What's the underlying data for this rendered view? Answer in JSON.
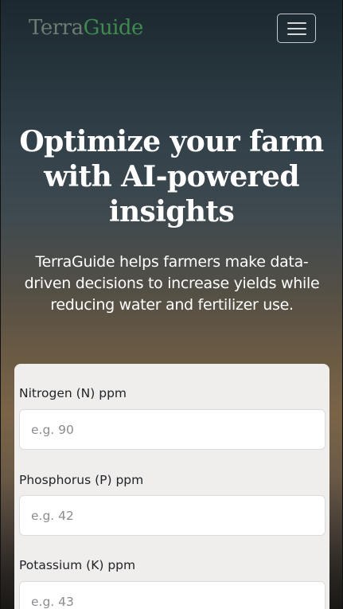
{
  "navbar": {
    "brand_part1": "Terra",
    "brand_part2": "Guide",
    "brand_color_part1": "#6f7a72",
    "brand_color_part2": "#3f8a4e",
    "menu_icon": "hamburger-menu-icon"
  },
  "hero": {
    "title": "Optimize your farm with AI-powered insights",
    "subtitle": "TerraGuide helps farmers make data-driven decisions to increase yields while reducing water and fertilizer use."
  },
  "form": {
    "fields": [
      {
        "label": "Nitrogen (N) ppm",
        "placeholder": "e.g. 90",
        "value": ""
      },
      {
        "label": "Phosphorus (P) ppm",
        "placeholder": "e.g. 42",
        "value": ""
      },
      {
        "label": "Potassium (K) ppm",
        "placeholder": "e.g. 43",
        "value": ""
      }
    ]
  }
}
